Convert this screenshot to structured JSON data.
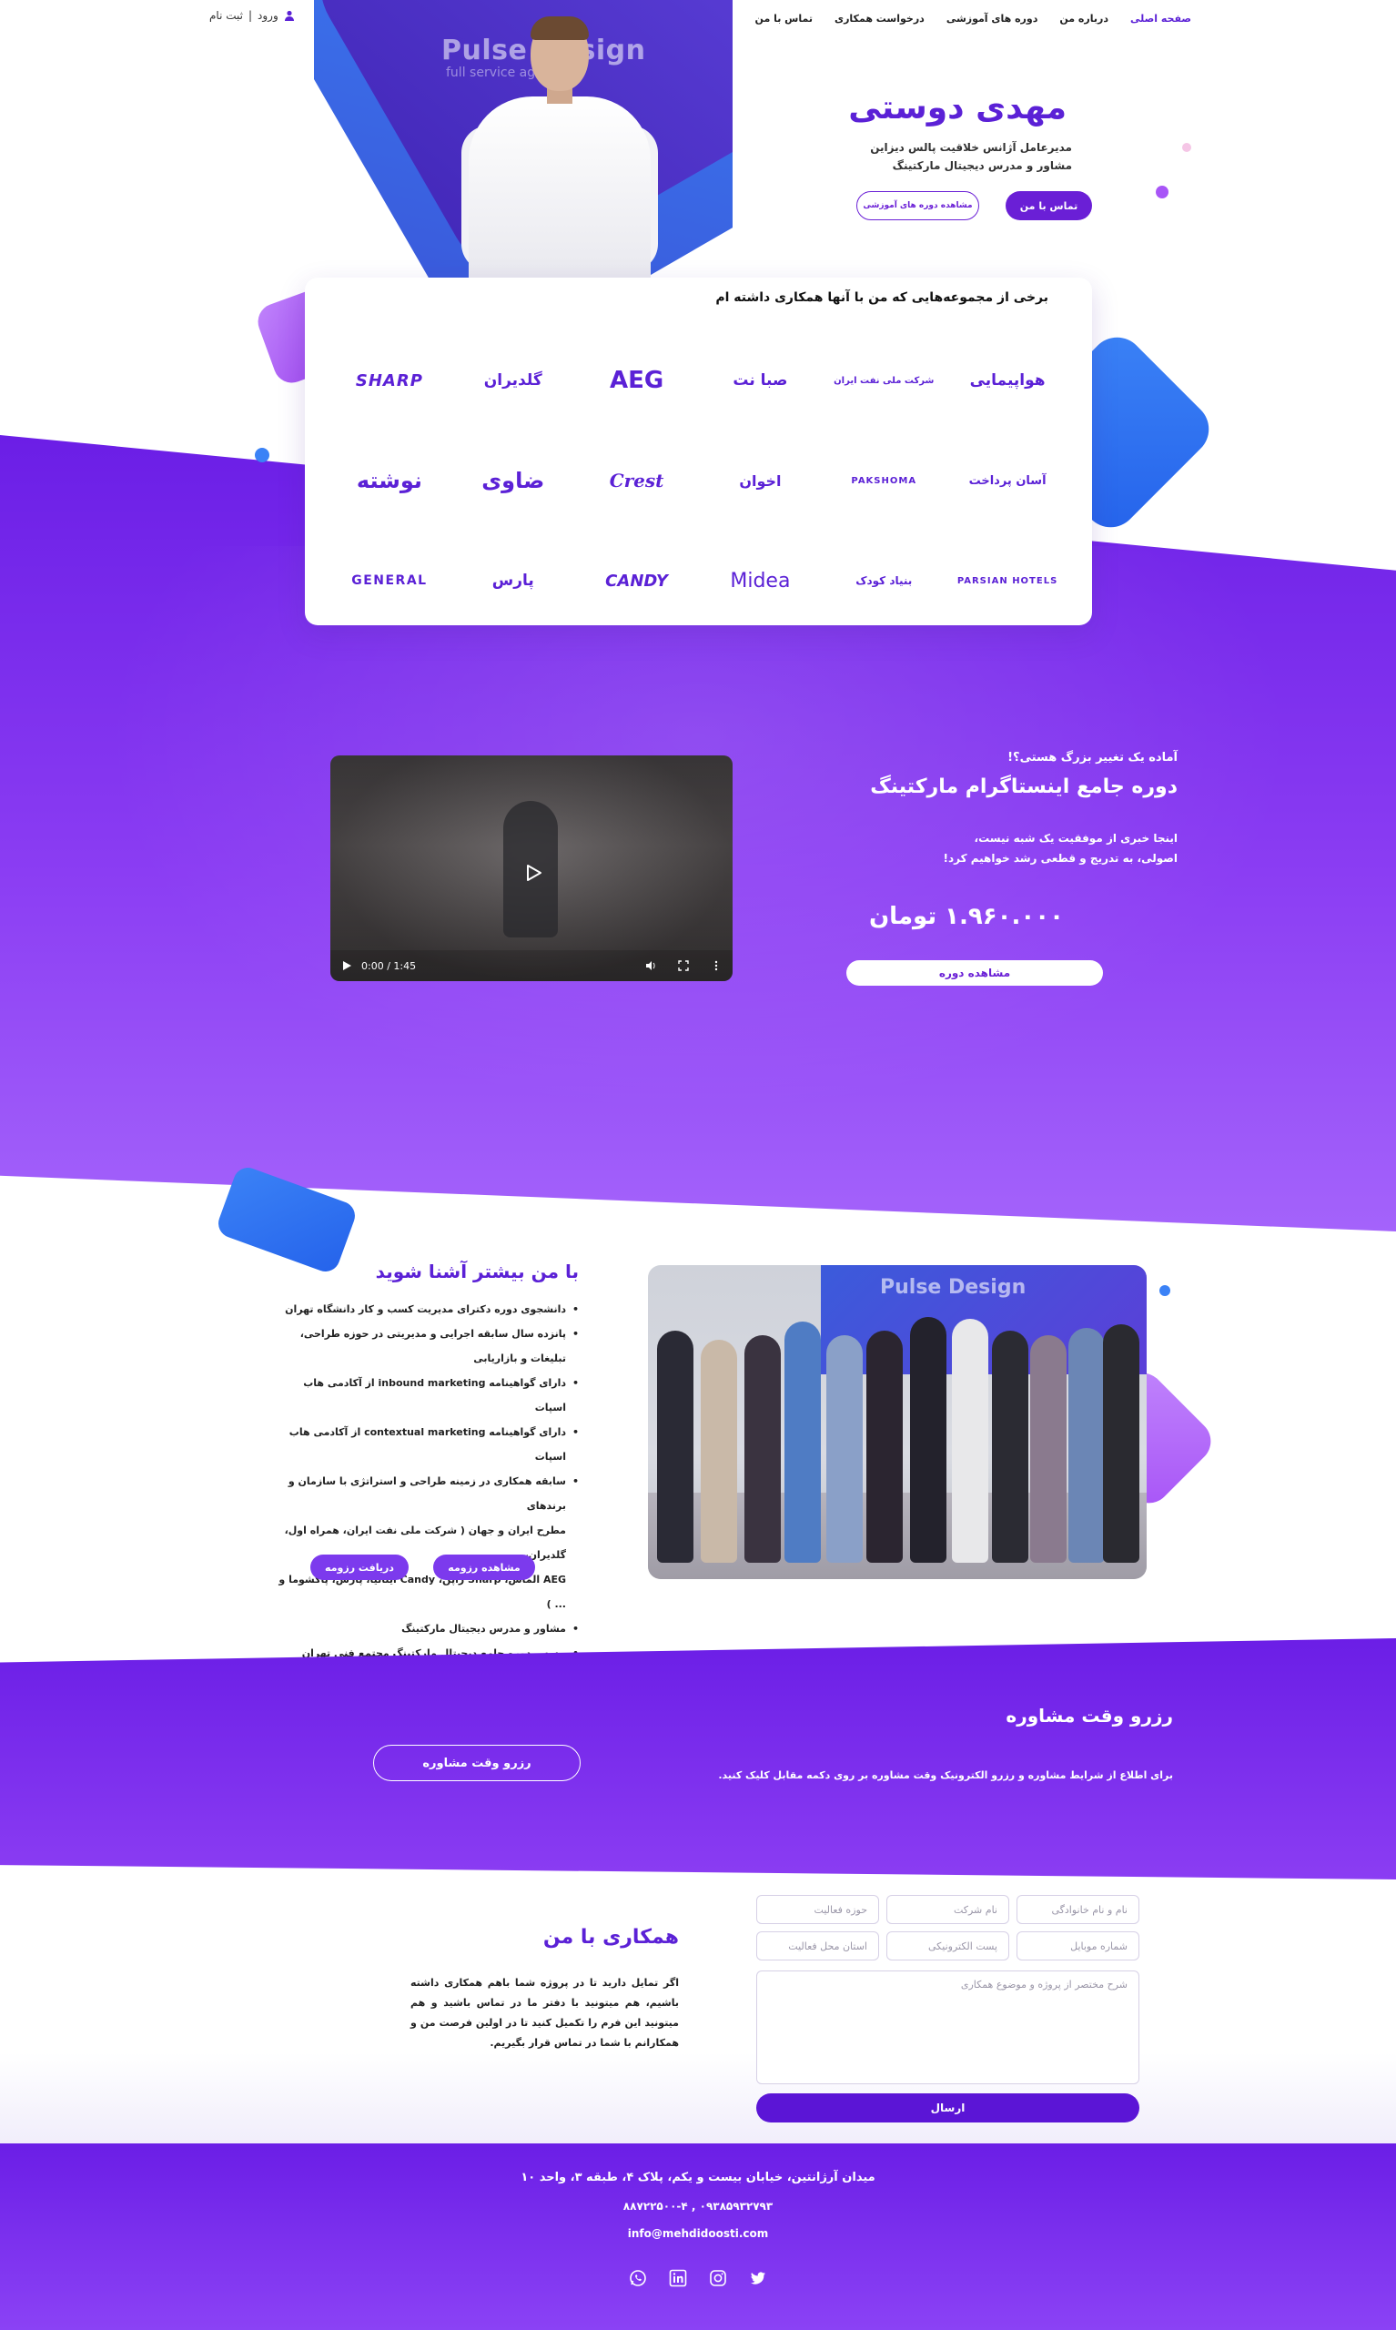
{
  "header": {
    "nav": [
      "صفحه اصلی",
      "درباره من",
      "دوره های آموزشی",
      "درخواست همکاری",
      "تماس با من"
    ],
    "login": "ورود",
    "separator": "|",
    "register": "ثبت نام"
  },
  "hero": {
    "brand_sign": "Pulse Design",
    "brand_sub": "full service agency",
    "name": "مهدی دوستی",
    "line1": "مدیرعامل آژانس خلاقیت پالس دیزاین",
    "line2": "مشاور و مدرس دیجیتال مارکتینگ",
    "btn_contact": "تماس با من",
    "btn_courses": "مشاهده دوره های آموزشی"
  },
  "clients": {
    "title": "برخی از مجموعه‌هایی که من با آنها همکاری داشته ام",
    "logos": [
      "SHARP",
      "گلدیران",
      "AEG",
      "صبا نت",
      "شرکت ملی نفت ایران",
      "هواپیمایی",
      "نوشته",
      "ضاوی",
      "Crest",
      "اخوان",
      "PAKSHOMA",
      "آسان پرداخت",
      "GENERAL",
      "پارس",
      "CANDY",
      "Midea",
      "بنیاد کودک",
      "PARSIAN HOTELS"
    ]
  },
  "course": {
    "kicker": "آماده یک تغییر بزرگ هستی؟!",
    "title": "دوره جامع اینستاگرام مارکتینگ",
    "desc1": "اینجا خبری از موفقیت یک شبه نیست،",
    "desc2": "اصولی، به تدریج و قطعی رشد خواهیم کرد!",
    "price": "۱.۹۶۰.۰۰۰ تومان",
    "btn": "مشاهده دوره",
    "video_time": "0:00 / 1:45"
  },
  "about": {
    "title": "با من بیشتر آشنا شوید",
    "items": [
      "دانشجوی دوره دکترای مدیریت کسب و کار دانشگاه تهران",
      "پانزده سال سابقه اجرایی و مدیریتی در حوزه طراحی، تبلیغات و بازاریابی",
      "دارای گواهینامه inbound marketing از آکادمی هاب اسپات",
      "دارای گواهینامه contextual marketing از آکادمی هاب اسپات",
      "سابقه همکاری در زمینه طراحی و استراتژی با سازمان و برندهای",
      "مطرح ایران و جهان ( شرکت ملی نفت ایران، همراه اول، گلدیران،",
      "AEG الماس، Sharp ژاپن، Candy ایتالیا، پارس، پاکشوما و ... )",
      "مشاور و مدرس دیجیتال مارکتینگ",
      "مدرس دوره جامع دیجیتال مارکتینگ مجتمع فنی تهران"
    ],
    "btn_view": "مشاهده رزومه",
    "btn_get": "دریافت رزومه",
    "photo_sign": "Pulse Design"
  },
  "consult": {
    "title": "رزرو وقت مشاوره",
    "desc": "برای اطلاع از شرایط مشاوره و رزرو الکترونیک وقت مشاوره بر روی دکمه مقابل کلیک کنید.",
    "btn": "رزرو وقت مشاوره"
  },
  "coop": {
    "title": "همکاری با من",
    "text": "اگر تمایل دارید تا در پروژه شما باهم همکاری داشته باشیم، هم میتونید با دفتر ما در تماس باشید و هم میتونید این فرم را تکمیل کنید تا در اولین فرصت من و همکارانم با شما در تماس قرار بگیریم.",
    "ph_name": "نام و نام خانوادگی",
    "ph_company": "نام شرکت",
    "ph_field": "حوزه فعالیت",
    "ph_mobile": "شماره موبایل",
    "ph_email": "پست الکترونیکی",
    "ph_province": "استان محل فعالیت",
    "ph_desc": "شرح مختصر از پروژه و موضوع همکاری",
    "btn_send": "ارسال"
  },
  "footer": {
    "address": "میدان آرژانتین، خیابان بیست و یکم، پلاک ۴، طبقه ۳، واحد ۱۰",
    "phone": "۰۹۳۸۵۹۳۲۷۹۳ , ۸۸۷۲۲۵۰۰-۴",
    "email": "info@mehdidoosti.com"
  },
  "colors": {
    "primary": "#5b21d6",
    "band": "#7c3aed",
    "accent_blue": "#3b82f6",
    "accent_pink": "#c084fc"
  }
}
